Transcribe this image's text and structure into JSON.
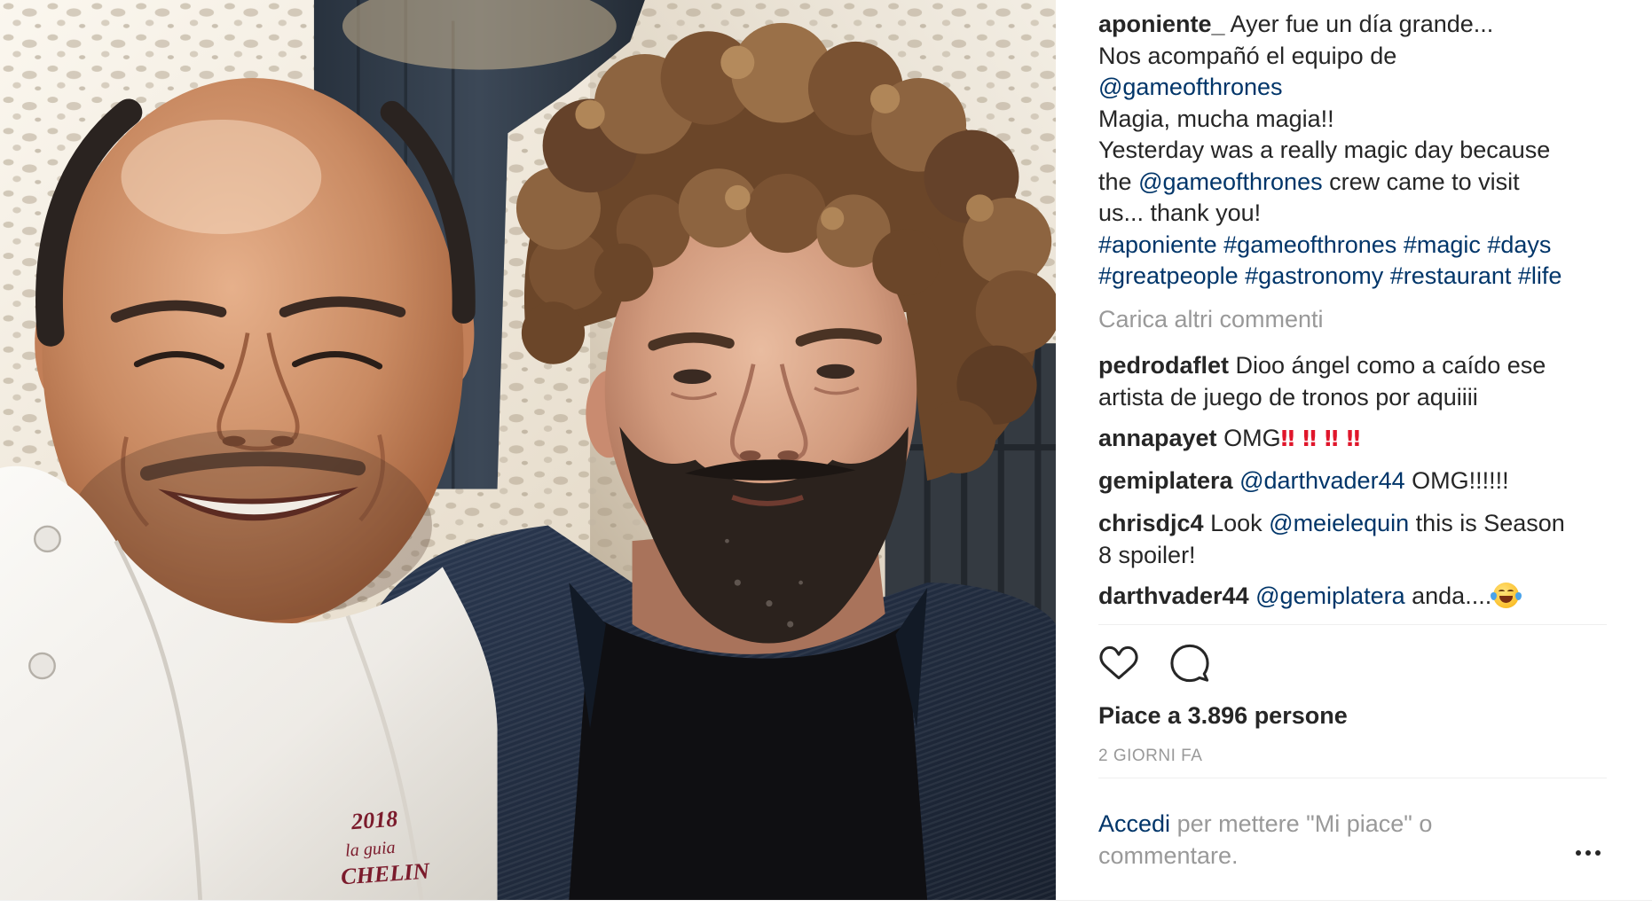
{
  "photo": {
    "jacket_text": {
      "year": "2018",
      "guide": "la guia",
      "brand": "CHELIN"
    }
  },
  "caption": {
    "username": "aponiente_",
    "segments": [
      "Ayer fue un día grande...",
      "Nos acompañó el equipo de",
      "@gameofthrones",
      "Magia, mucha magia!!",
      "Yesterday was a really magic day because",
      "the",
      "@gameofthrones",
      "crew came to visit",
      "us... thank you!"
    ],
    "hashtags": [
      "#aponiente",
      "#gameofthrones",
      "#magic",
      "#days",
      "#greatpeople",
      "#gastronomy",
      "#restaurant",
      "#life"
    ]
  },
  "load_more_comments": "Carica altri commenti",
  "comments": [
    {
      "username": "pedrodaflet",
      "text": [
        "Dioo ángel como a caído ese",
        "artista de juego de tronos por aquiiii"
      ]
    },
    {
      "username": "annapayet",
      "text": "OMG",
      "emoji": "‼‼‼‼"
    },
    {
      "username": "gemiplatera",
      "mention": "@darthvader44",
      "text": "OMG!!!!!!"
    },
    {
      "username": "chrisdjc4",
      "text_before": "Look",
      "mention": "@meielequin",
      "text_after": "this is Season",
      "text_line2": "8 spoiler!"
    },
    {
      "username": "darthvader44",
      "mention": "@gemiplatera",
      "text": "anda....",
      "emoji_icon": "face-with-tears-of-joy"
    }
  ],
  "actions": {
    "like_icon": "heart-outline",
    "comment_icon": "speech-bubble-outline"
  },
  "likes": {
    "prefix": "Piace a",
    "count": "3.896",
    "suffix": "persone"
  },
  "timestamp": "2 GIORNI FA",
  "login_prompt": {
    "link": "Accedi",
    "text_line1": "per mettere \"Mi piace\" o",
    "text_line2": "commentare."
  },
  "more_options_icon": "more-horizontal",
  "colors": {
    "text": "#262626",
    "link": "#003569",
    "muted": "#999999",
    "emoji_red": "#e0162b",
    "divider": "#efefef"
  }
}
